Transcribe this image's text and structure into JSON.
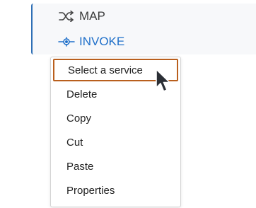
{
  "workflow": {
    "steps": [
      {
        "label": "MAP",
        "icon": "shuffle-icon"
      },
      {
        "label": "INVOKE",
        "icon": "service-connector-icon"
      }
    ],
    "accent_color": "#2f6fb5",
    "invoke_color": "#1e6fc9"
  },
  "context_menu": {
    "items": [
      {
        "label": "Select a service",
        "highlighted": true
      },
      {
        "label": "Delete"
      },
      {
        "label": "Copy"
      },
      {
        "label": "Cut"
      },
      {
        "label": "Paste"
      },
      {
        "label": "Properties"
      }
    ],
    "highlight_color": "#b95f1d"
  },
  "cursor": {
    "icon": "mouse-pointer-icon"
  }
}
